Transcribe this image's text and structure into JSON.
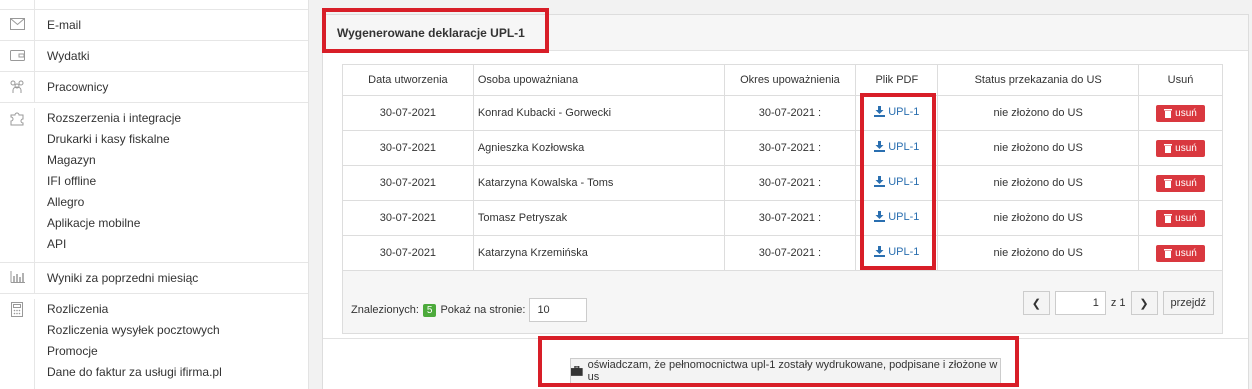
{
  "sidebar": {
    "groups": [
      {
        "icon": "envelope-icon",
        "items": [
          "E-mail"
        ]
      },
      {
        "icon": "wallet-icon",
        "items": [
          "Wydatki"
        ]
      },
      {
        "icon": "people-icon",
        "items": [
          "Pracownicy"
        ]
      },
      {
        "icon": "puzzle-icon",
        "items": [
          "Rozszerzenia i integracje",
          "Drukarki i kasy fiskalne",
          "Magazyn",
          "IFI offline",
          "Allegro",
          "Aplikacje mobilne",
          "API"
        ]
      },
      {
        "icon": "bar-chart-icon",
        "items": [
          "Wyniki za poprzedni miesiąc"
        ]
      },
      {
        "icon": "calculator-icon",
        "items": [
          "Rozliczenia",
          "Rozliczenia wysyłek pocztowych",
          "Promocje",
          "Dane do faktur za usługi ifirma.pl"
        ]
      }
    ]
  },
  "panel": {
    "title": "Wygenerowane deklaracje UPL-1"
  },
  "table": {
    "headers": [
      "Data utworzenia",
      "Osoba upoważniana",
      "Okres upoważnienia",
      "Plik PDF",
      "Status przekazania do US",
      "Usuń"
    ],
    "rows": [
      {
        "date": "30-07-2021",
        "person": "Konrad Kubacki - Gorwecki",
        "period": "30-07-2021 :",
        "pdf": "UPL-1",
        "status": "nie złożono do US",
        "delete": "usuń"
      },
      {
        "date": "30-07-2021",
        "person": "Agnieszka Kozłowska",
        "period": "30-07-2021 :",
        "pdf": "UPL-1",
        "status": "nie złożono do US",
        "delete": "usuń"
      },
      {
        "date": "30-07-2021",
        "person": "Katarzyna Kowalska - Toms",
        "period": "30-07-2021 :",
        "pdf": "UPL-1",
        "status": "nie złożono do US",
        "delete": "usuń"
      },
      {
        "date": "30-07-2021",
        "person": "Tomasz Petryszak",
        "period": "30-07-2021 :",
        "pdf": "UPL-1",
        "status": "nie złożono do US",
        "delete": "usuń"
      },
      {
        "date": "30-07-2021",
        "person": "Katarzyna Krzemińska",
        "period": "30-07-2021 :",
        "pdf": "UPL-1",
        "status": "nie złożono do US",
        "delete": "usuń"
      }
    ]
  },
  "footer": {
    "found_label": "Znalezionych:",
    "found_count": "5",
    "per_page_label": "Pokaż na stronie:",
    "per_page_value": "10",
    "page_value": "1",
    "page_of": "z 1",
    "go_label": "przejdź"
  },
  "confirm": {
    "label": "oświadczam, że pełnomocnictwa upl-1 zostały wydrukowane, podpisane i złożone w us"
  },
  "colors": {
    "highlight": "#d81e28",
    "delete_button": "#d9383f",
    "link": "#2a6fb0",
    "badge": "#4caa3b"
  }
}
